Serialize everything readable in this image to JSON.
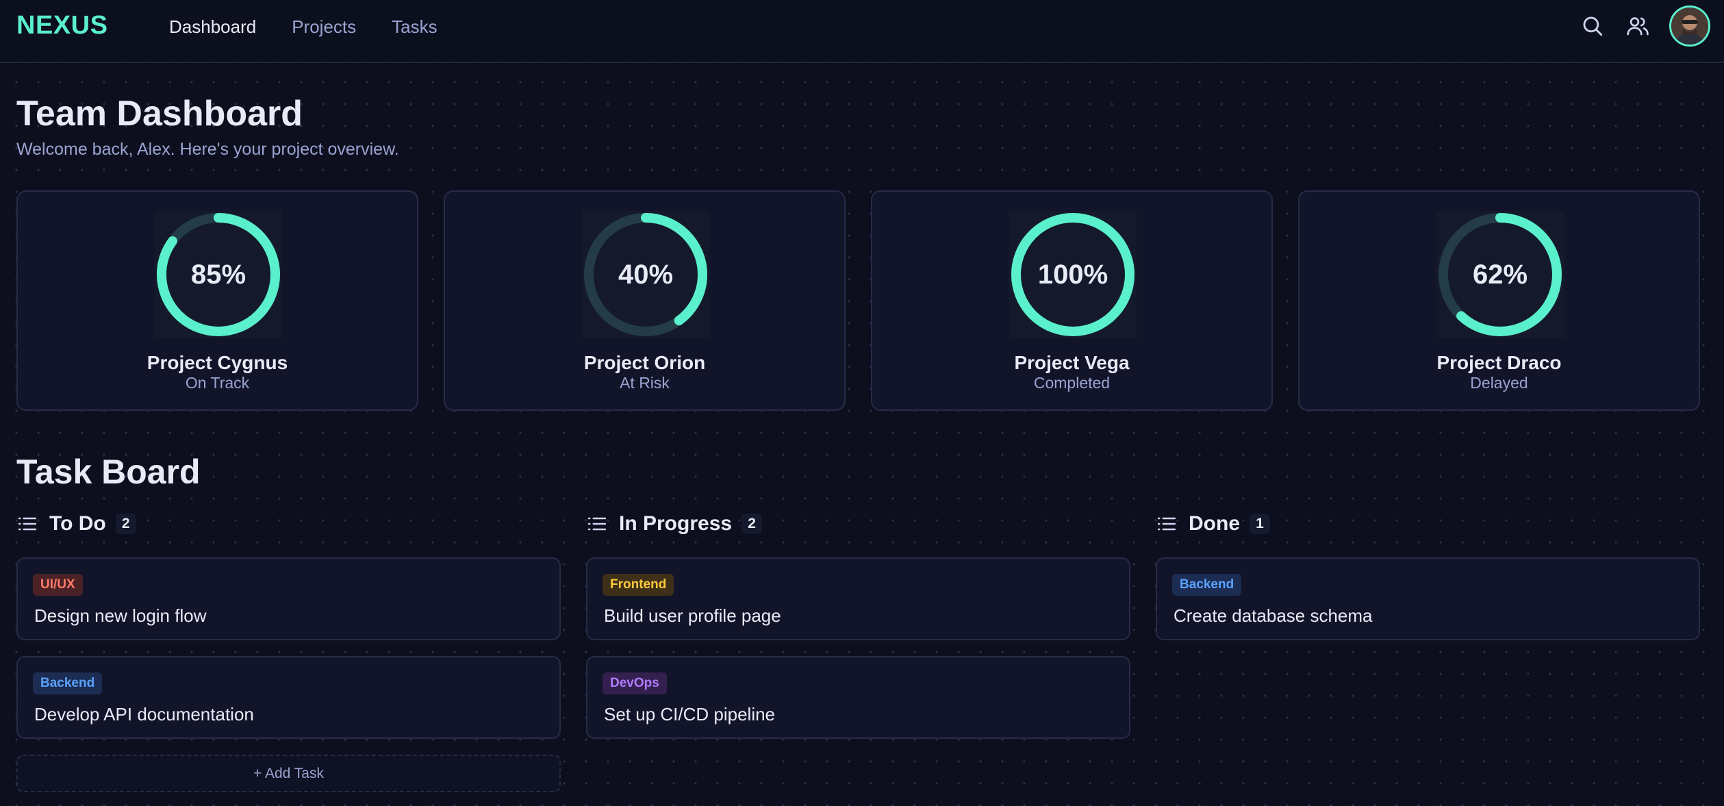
{
  "colors": {
    "accent": "#5af0cc",
    "ring_track": "#243c47",
    "background": "#0d0f1e",
    "card": "#12152a"
  },
  "header": {
    "logo": "NEXUS",
    "nav": [
      {
        "label": "Dashboard",
        "active": true
      },
      {
        "label": "Projects",
        "active": false
      },
      {
        "label": "Tasks",
        "active": false
      }
    ],
    "icons": [
      "search-icon",
      "users-icon",
      "avatar"
    ]
  },
  "page": {
    "title": "Team Dashboard",
    "subtitle": "Welcome back, Alex. Here's your project overview."
  },
  "projects": [
    {
      "name": "Project Cygnus",
      "status": "On Track",
      "progress_label": "85%",
      "progress": 0.85
    },
    {
      "name": "Project Orion",
      "status": "At Risk",
      "progress_label": "40%",
      "progress": 0.4
    },
    {
      "name": "Project Vega",
      "status": "Completed",
      "progress_label": "100%",
      "progress": 1.0
    },
    {
      "name": "Project Draco",
      "status": "Delayed",
      "progress_label": "62%",
      "progress": 0.62
    }
  ],
  "board": {
    "title": "Task Board",
    "add_task_label": "+ Add Task",
    "columns": [
      {
        "name": "To Do",
        "count": "2",
        "tasks": [
          {
            "tag": "UI/UX",
            "tag_color": "#ff7a6b",
            "tag_bg": "#4a2226",
            "title": "Design new login flow"
          },
          {
            "tag": "Backend",
            "tag_color": "#5aa2ff",
            "tag_bg": "#1c2c52",
            "title": "Develop API documentation"
          }
        ]
      },
      {
        "name": "In Progress",
        "count": "2",
        "tasks": [
          {
            "tag": "Frontend",
            "tag_color": "#ffc83a",
            "tag_bg": "#3e3018",
            "title": "Build user profile page"
          },
          {
            "tag": "DevOps",
            "tag_color": "#b27bff",
            "tag_bg": "#33204f",
            "title": "Set up CI/CD pipeline"
          }
        ]
      },
      {
        "name": "Done",
        "count": "1",
        "tasks": [
          {
            "tag": "Backend",
            "tag_color": "#5aa2ff",
            "tag_bg": "#1c2c52",
            "title": "Create database schema"
          }
        ]
      }
    ]
  }
}
